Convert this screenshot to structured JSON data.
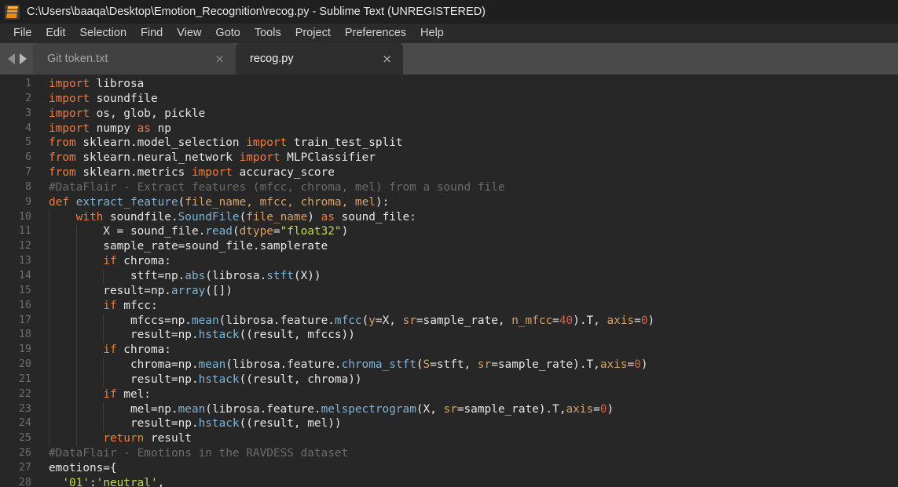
{
  "window": {
    "title": "C:\\Users\\baaqa\\Desktop\\Emotion_Recognition\\recog.py - Sublime Text (UNREGISTERED)",
    "app_icon": "sublime-text-icon"
  },
  "menubar": {
    "items": [
      {
        "label": "File"
      },
      {
        "label": "Edit"
      },
      {
        "label": "Selection"
      },
      {
        "label": "Find"
      },
      {
        "label": "View"
      },
      {
        "label": "Goto"
      },
      {
        "label": "Tools"
      },
      {
        "label": "Project"
      },
      {
        "label": "Preferences"
      },
      {
        "label": "Help"
      }
    ]
  },
  "tabbar": {
    "nav_back_icon": "arrow-left-icon",
    "nav_forward_icon": "arrow-right-icon",
    "close_glyph": "×",
    "tabs": [
      {
        "label": "Git token.txt",
        "active": false
      },
      {
        "label": "recog.py",
        "active": true
      }
    ]
  },
  "editor": {
    "language": "Python",
    "first_line": 1,
    "last_line": 28,
    "colors": {
      "background": "#272727",
      "foreground": "#e6e6e6",
      "gutter": "#6e6e6e",
      "keyword": "#f07b3f",
      "function": "#7fb3d5",
      "string": "#c6d94a",
      "comment": "#6b6b6b",
      "number": "#e05c4a",
      "parameter": "#d9a066"
    },
    "lines": [
      {
        "n": 1,
        "text": "import librosa"
      },
      {
        "n": 2,
        "text": "import soundfile"
      },
      {
        "n": 3,
        "text": "import os, glob, pickle"
      },
      {
        "n": 4,
        "text": "import numpy as np"
      },
      {
        "n": 5,
        "text": "from sklearn.model_selection import train_test_split"
      },
      {
        "n": 6,
        "text": "from sklearn.neural_network import MLPClassifier"
      },
      {
        "n": 7,
        "text": "from sklearn.metrics import accuracy_score"
      },
      {
        "n": 8,
        "text": "#DataFlair - Extract features (mfcc, chroma, mel) from a sound file"
      },
      {
        "n": 9,
        "text": "def extract_feature(file_name, mfcc, chroma, mel):"
      },
      {
        "n": 10,
        "text": "    with soundfile.SoundFile(file_name) as sound_file:"
      },
      {
        "n": 11,
        "text": "        X = sound_file.read(dtype=\"float32\")"
      },
      {
        "n": 12,
        "text": "        sample_rate=sound_file.samplerate"
      },
      {
        "n": 13,
        "text": "        if chroma:"
      },
      {
        "n": 14,
        "text": "            stft=np.abs(librosa.stft(X))"
      },
      {
        "n": 15,
        "text": "        result=np.array([])"
      },
      {
        "n": 16,
        "text": "        if mfcc:"
      },
      {
        "n": 17,
        "text": "            mfccs=np.mean(librosa.feature.mfcc(y=X, sr=sample_rate, n_mfcc=40).T, axis=0)"
      },
      {
        "n": 18,
        "text": "            result=np.hstack((result, mfccs))"
      },
      {
        "n": 19,
        "text": "        if chroma:"
      },
      {
        "n": 20,
        "text": "            chroma=np.mean(librosa.feature.chroma_stft(S=stft, sr=sample_rate).T,axis=0)"
      },
      {
        "n": 21,
        "text": "            result=np.hstack((result, chroma))"
      },
      {
        "n": 22,
        "text": "        if mel:"
      },
      {
        "n": 23,
        "text": "            mel=np.mean(librosa.feature.melspectrogram(X, sr=sample_rate).T,axis=0)"
      },
      {
        "n": 24,
        "text": "            result=np.hstack((result, mel))"
      },
      {
        "n": 25,
        "text": "        return result"
      },
      {
        "n": 26,
        "text": "#DataFlair - Emotions in the RAVDESS dataset"
      },
      {
        "n": 27,
        "text": "emotions={"
      },
      {
        "n": 28,
        "text": "  '01':'neutral',"
      }
    ],
    "tokens": [
      [
        [
          "import",
          "t-kw"
        ],
        [
          " librosa",
          "t-op"
        ]
      ],
      [
        [
          "import",
          "t-kw"
        ],
        [
          " soundfile",
          "t-op"
        ]
      ],
      [
        [
          "import",
          "t-kw"
        ],
        [
          " os, glob, pickle",
          "t-op"
        ]
      ],
      [
        [
          "import",
          "t-kw"
        ],
        [
          " numpy ",
          "t-op"
        ],
        [
          "as",
          "t-kw"
        ],
        [
          " np",
          "t-op"
        ]
      ],
      [
        [
          "from",
          "t-kw"
        ],
        [
          " sklearn.model_selection ",
          "t-op"
        ],
        [
          "import",
          "t-kw"
        ],
        [
          " train_test_split",
          "t-op"
        ]
      ],
      [
        [
          "from",
          "t-kw"
        ],
        [
          " sklearn.neural_network ",
          "t-op"
        ],
        [
          "import",
          "t-kw"
        ],
        [
          " MLPClassifier",
          "t-op"
        ]
      ],
      [
        [
          "from",
          "t-kw"
        ],
        [
          " sklearn.metrics ",
          "t-op"
        ],
        [
          "import",
          "t-kw"
        ],
        [
          " accuracy_score",
          "t-op"
        ]
      ],
      [
        [
          "#DataFlair - Extract features (mfcc, chroma, mel) from a sound file",
          "t-com"
        ]
      ],
      [
        [
          "def",
          "t-kw"
        ],
        [
          " ",
          "t-op"
        ],
        [
          "extract_feature",
          "t-fn"
        ],
        [
          "(",
          "t-op"
        ],
        [
          "file_name, mfcc, chroma, mel",
          "t-par"
        ],
        [
          "):",
          "t-op"
        ]
      ],
      [
        [
          "    ",
          "t-op"
        ],
        [
          "with",
          "t-kw"
        ],
        [
          " soundfile.",
          "t-op"
        ],
        [
          "SoundFile",
          "t-fn"
        ],
        [
          "(",
          "t-op"
        ],
        [
          "file_name",
          "t-par"
        ],
        [
          ") ",
          "t-op"
        ],
        [
          "as",
          "t-kw"
        ],
        [
          " sound_file:",
          "t-op"
        ]
      ],
      [
        [
          "        X = sound_file.",
          "t-op"
        ],
        [
          "read",
          "t-fn"
        ],
        [
          "(",
          "t-op"
        ],
        [
          "dtype",
          "t-par"
        ],
        [
          "=",
          "t-op"
        ],
        [
          "\"float32\"",
          "t-str"
        ],
        [
          ")",
          "t-op"
        ]
      ],
      [
        [
          "        sample_rate=sound_file.samplerate",
          "t-op"
        ]
      ],
      [
        [
          "        ",
          "t-op"
        ],
        [
          "if",
          "t-kw"
        ],
        [
          " chroma:",
          "t-op"
        ]
      ],
      [
        [
          "            stft=np.",
          "t-op"
        ],
        [
          "abs",
          "t-fn"
        ],
        [
          "(librosa.",
          "t-op"
        ],
        [
          "stft",
          "t-fn"
        ],
        [
          "(X))",
          "t-op"
        ]
      ],
      [
        [
          "        result=np.",
          "t-op"
        ],
        [
          "array",
          "t-fn"
        ],
        [
          "([])",
          "t-op"
        ]
      ],
      [
        [
          "        ",
          "t-op"
        ],
        [
          "if",
          "t-kw"
        ],
        [
          " mfcc:",
          "t-op"
        ]
      ],
      [
        [
          "            mfccs=np.",
          "t-op"
        ],
        [
          "mean",
          "t-fn"
        ],
        [
          "(librosa.feature.",
          "t-op"
        ],
        [
          "mfcc",
          "t-fn"
        ],
        [
          "(",
          "t-op"
        ],
        [
          "y",
          "t-par"
        ],
        [
          "=X, ",
          "t-op"
        ],
        [
          "sr",
          "t-par"
        ],
        [
          "=sample_rate, ",
          "t-op"
        ],
        [
          "n_mfcc",
          "t-par"
        ],
        [
          "=",
          "t-op"
        ],
        [
          "40",
          "t-num"
        ],
        [
          ").T, ",
          "t-op"
        ],
        [
          "axis",
          "t-par"
        ],
        [
          "=",
          "t-op"
        ],
        [
          "0",
          "t-num"
        ],
        [
          ")",
          "t-op"
        ]
      ],
      [
        [
          "            result=np.",
          "t-op"
        ],
        [
          "hstack",
          "t-fn"
        ],
        [
          "((result, mfccs))",
          "t-op"
        ]
      ],
      [
        [
          "        ",
          "t-op"
        ],
        [
          "if",
          "t-kw"
        ],
        [
          " chroma:",
          "t-op"
        ]
      ],
      [
        [
          "            chroma=np.",
          "t-op"
        ],
        [
          "mean",
          "t-fn"
        ],
        [
          "(librosa.feature.",
          "t-op"
        ],
        [
          "chroma_stft",
          "t-fn"
        ],
        [
          "(",
          "t-op"
        ],
        [
          "S",
          "t-par"
        ],
        [
          "=stft, ",
          "t-op"
        ],
        [
          "sr",
          "t-par"
        ],
        [
          "=sample_rate).T,",
          "t-op"
        ],
        [
          "axis",
          "t-par"
        ],
        [
          "=",
          "t-op"
        ],
        [
          "0",
          "t-num"
        ],
        [
          ")",
          "t-op"
        ]
      ],
      [
        [
          "            result=np.",
          "t-op"
        ],
        [
          "hstack",
          "t-fn"
        ],
        [
          "((result, chroma))",
          "t-op"
        ]
      ],
      [
        [
          "        ",
          "t-op"
        ],
        [
          "if",
          "t-kw"
        ],
        [
          " mel:",
          "t-op"
        ]
      ],
      [
        [
          "            mel=np.",
          "t-op"
        ],
        [
          "mean",
          "t-fn"
        ],
        [
          "(librosa.feature.",
          "t-op"
        ],
        [
          "melspectrogram",
          "t-fn"
        ],
        [
          "(X, ",
          "t-op"
        ],
        [
          "sr",
          "t-par"
        ],
        [
          "=sample_rate).T,",
          "t-op"
        ],
        [
          "axis",
          "t-par"
        ],
        [
          "=",
          "t-op"
        ],
        [
          "0",
          "t-num"
        ],
        [
          ")",
          "t-op"
        ]
      ],
      [
        [
          "            result=np.",
          "t-op"
        ],
        [
          "hstack",
          "t-fn"
        ],
        [
          "((result, mel))",
          "t-op"
        ]
      ],
      [
        [
          "        ",
          "t-op"
        ],
        [
          "return",
          "t-kw"
        ],
        [
          " result",
          "t-op"
        ]
      ],
      [
        [
          "#DataFlair - Emotions in the RAVDESS dataset",
          "t-com"
        ]
      ],
      [
        [
          "emotions={",
          "t-op"
        ]
      ],
      [
        [
          "  ",
          "t-op"
        ],
        [
          "'01'",
          "t-str"
        ],
        [
          ":",
          "t-op"
        ],
        [
          "'neutral'",
          "t-str"
        ],
        [
          ",",
          "t-op"
        ]
      ]
    ]
  }
}
